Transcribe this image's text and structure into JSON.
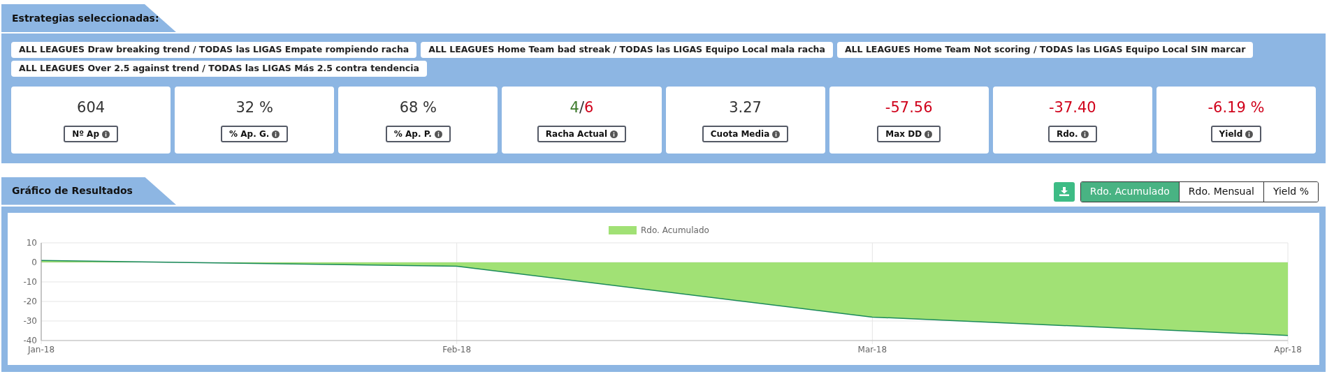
{
  "strategies_section": {
    "title": "Estrategias seleccionadas:",
    "tags": [
      "ALL LEAGUES Draw breaking trend / TODAS las LIGAS Empate rompiendo racha",
      "ALL LEAGUES Home Team bad streak / TODAS las LIGAS Equipo Local mala racha",
      "ALL LEAGUES Home Team Not scoring / TODAS las LIGAS Equipo Local SIN marcar",
      "ALL LEAGUES Over 2.5 against trend / TODAS las LIGAS Más 2.5 contra tendencia"
    ]
  },
  "stats": [
    {
      "label": "Nº Ap",
      "parts": [
        {
          "text": "604",
          "color": "#333333"
        }
      ]
    },
    {
      "label": "% Ap. G.",
      "parts": [
        {
          "text": "32 %",
          "color": "#333333"
        }
      ]
    },
    {
      "label": "% Ap. P.",
      "parts": [
        {
          "text": "68 %",
          "color": "#333333"
        }
      ]
    },
    {
      "label": "Racha Actual",
      "parts": [
        {
          "text": "4",
          "color": "#3c7a2a"
        },
        {
          "text": "/",
          "color": "#333333"
        },
        {
          "text": "6",
          "color": "#d0021b"
        }
      ]
    },
    {
      "label": "Cuota Media",
      "parts": [
        {
          "text": "3.27",
          "color": "#333333"
        }
      ]
    },
    {
      "label": "Max DD",
      "parts": [
        {
          "text": "-57.56",
          "color": "#d0021b"
        }
      ]
    },
    {
      "label": "Rdo.",
      "parts": [
        {
          "text": "-37.40",
          "color": "#d0021b"
        }
      ]
    },
    {
      "label": "Yield",
      "parts": [
        {
          "text": "-6.19 %",
          "color": "#d0021b"
        }
      ]
    }
  ],
  "results_section": {
    "title": "Gráfico de Resultados",
    "tabs": [
      {
        "label": "Rdo. Acumulado",
        "selected": true
      },
      {
        "label": "Rdo. Mensual",
        "selected": false
      },
      {
        "label": "Yield %",
        "selected": false
      }
    ],
    "chart_data": {
      "type": "area",
      "categories": [
        "Jan-18",
        "Feb-18",
        "Mar-18",
        "Apr-18"
      ],
      "series": [
        {
          "name": "Rdo. Acumulado",
          "color": "#a1e175",
          "values": [
            1,
            -2,
            -28,
            -37.4
          ]
        }
      ],
      "grid": true,
      "ylim": [
        -40,
        10
      ],
      "yticks": [
        10,
        0,
        -10,
        -20,
        -30,
        -40
      ]
    }
  }
}
